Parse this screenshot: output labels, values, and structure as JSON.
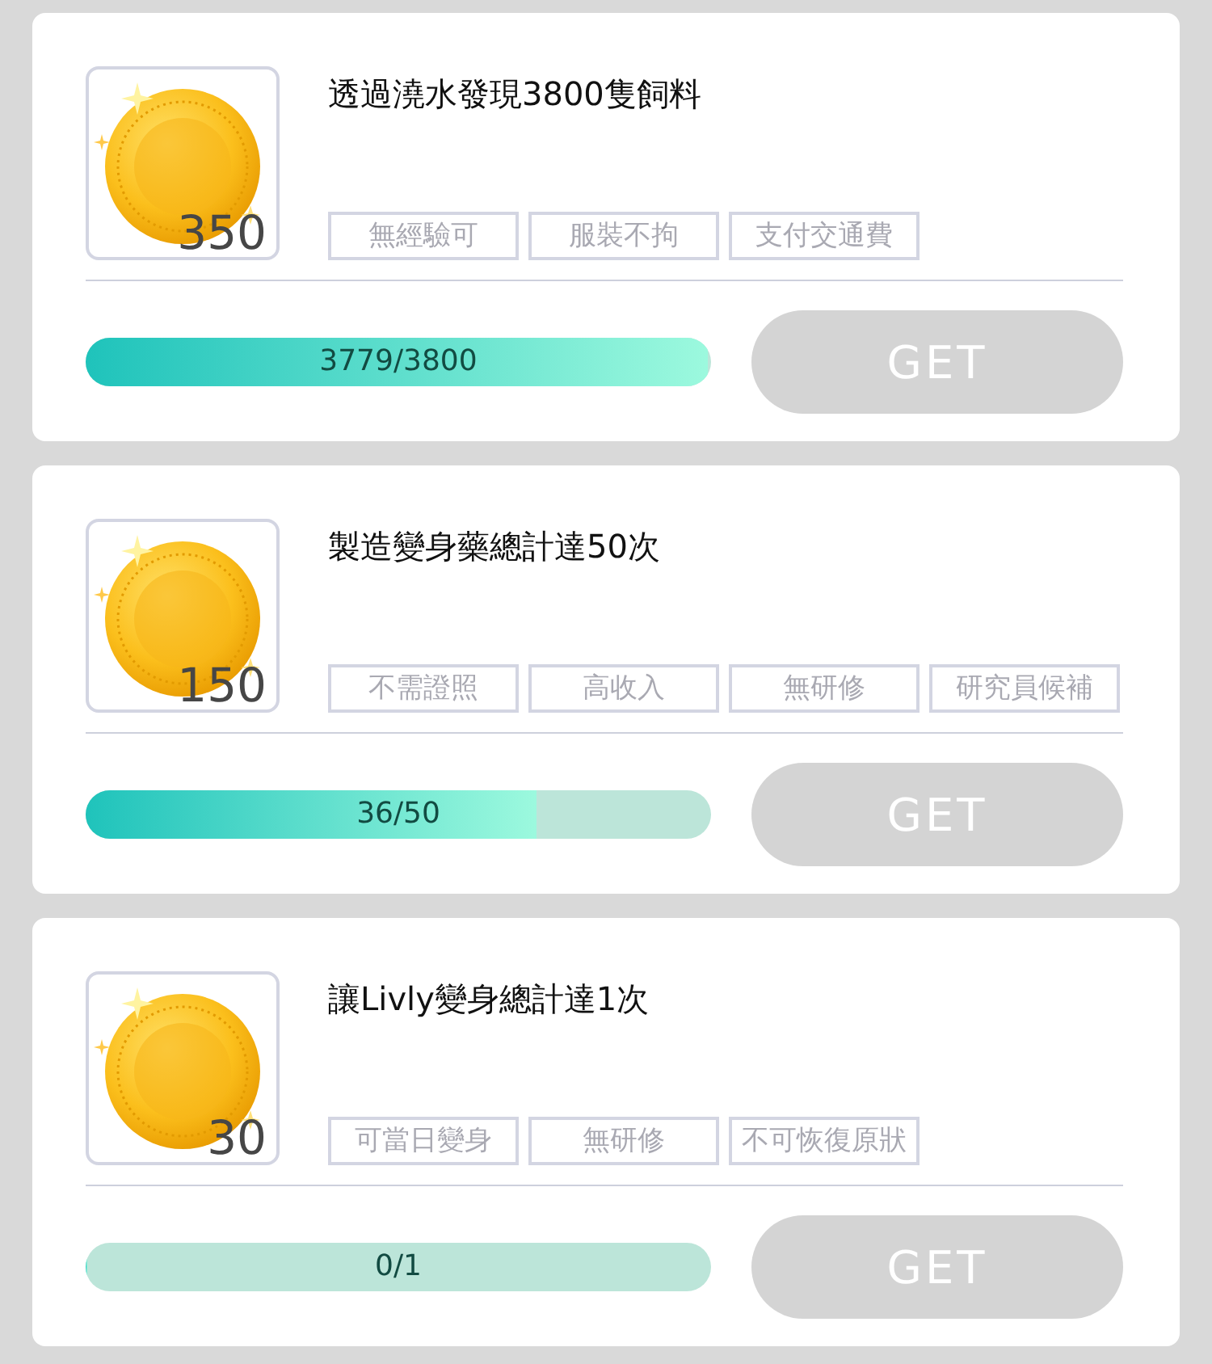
{
  "tasks": [
    {
      "title": "透過澆水發現3800隻飼料",
      "reward": "350",
      "tags": [
        "無經驗可",
        "服裝不拘",
        "支付交通費"
      ],
      "progress": {
        "level": 0.9945,
        "reading": "3779/3800"
      },
      "button": {
        "label": "GET",
        "disabled": true
      }
    },
    {
      "title": "製造變身藥總計達50次",
      "reward": "150",
      "tags": [
        "不需證照",
        "高收入",
        "無研修",
        "研究員候補"
      ],
      "progress": {
        "level": 0.72,
        "reading": "36/50"
      },
      "button": {
        "label": "GET",
        "disabled": true
      }
    },
    {
      "title": "讓Livly變身總計達1次",
      "reward": "30",
      "tags": [
        "可當日變身",
        "無研修",
        "不可恢復原狀"
      ],
      "progress": {
        "level": 0,
        "reading": "0/1"
      },
      "button": {
        "label": "GET",
        "disabled": true
      }
    }
  ]
}
